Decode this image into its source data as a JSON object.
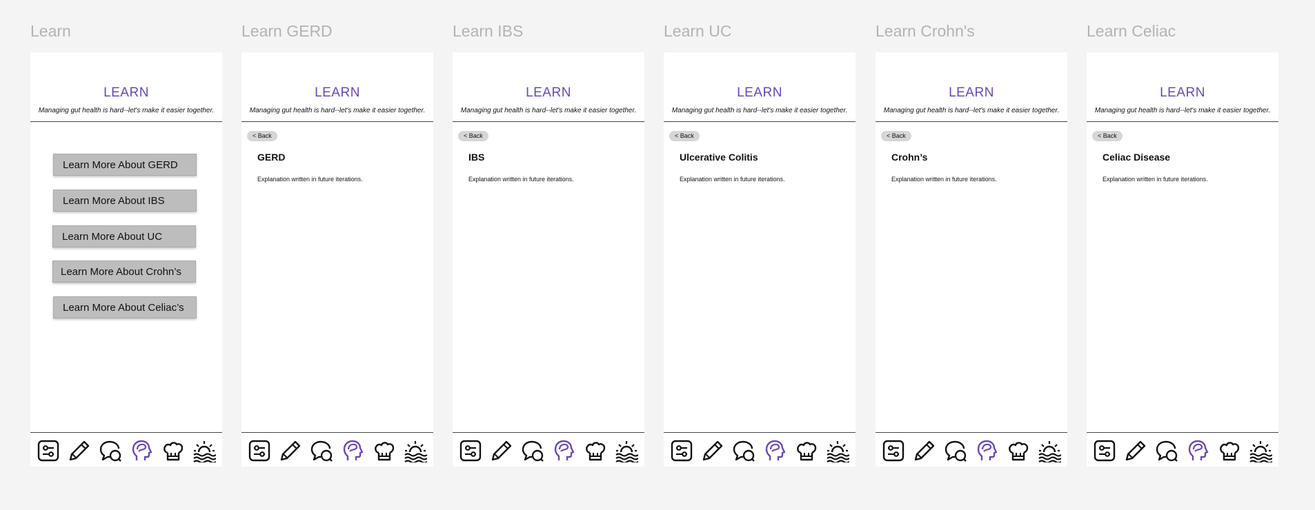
{
  "header": {
    "title": "LEARN",
    "tagline": "Managing gut health is hard--let's make it easier together."
  },
  "colors": {
    "accent": "#6a47b8",
    "canvas": "#f4f4f4",
    "button_bg": "#bdbdbd",
    "back_bg": "#d6d6d6"
  },
  "nav_icons": [
    "settings-sliders-icon",
    "pencil-icon",
    "chat-bubbles-icon",
    "brain-head-icon",
    "chef-hat-icon",
    "sunrise-icon"
  ],
  "nav_active": "brain-head-icon",
  "frames": [
    {
      "label": "Learn",
      "menu": [
        "Learn More About GERD",
        "Learn More About IBS",
        "Learn More About UC",
        "Learn More About Crohn’s",
        "Learn More About Celiac’s"
      ]
    },
    {
      "label": "Learn GERD",
      "back": "< Back",
      "topic": "GERD",
      "body": "Explanation written in future iterations."
    },
    {
      "label": "Learn IBS",
      "back": "< Back",
      "topic": "IBS",
      "body": "Explanation written in future iterations."
    },
    {
      "label": "Learn UC",
      "back": "< Back",
      "topic": "Ulcerative Colitis",
      "body": "Explanation written in future iterations."
    },
    {
      "label": "Learn Crohn's",
      "back": "< Back",
      "topic": "Crohn’s",
      "body": "Explanation written in future iterations."
    },
    {
      "label": "Learn Celiac",
      "back": "< Back",
      "topic": "Celiac Disease",
      "body": "Explanation written in future iterations."
    }
  ]
}
